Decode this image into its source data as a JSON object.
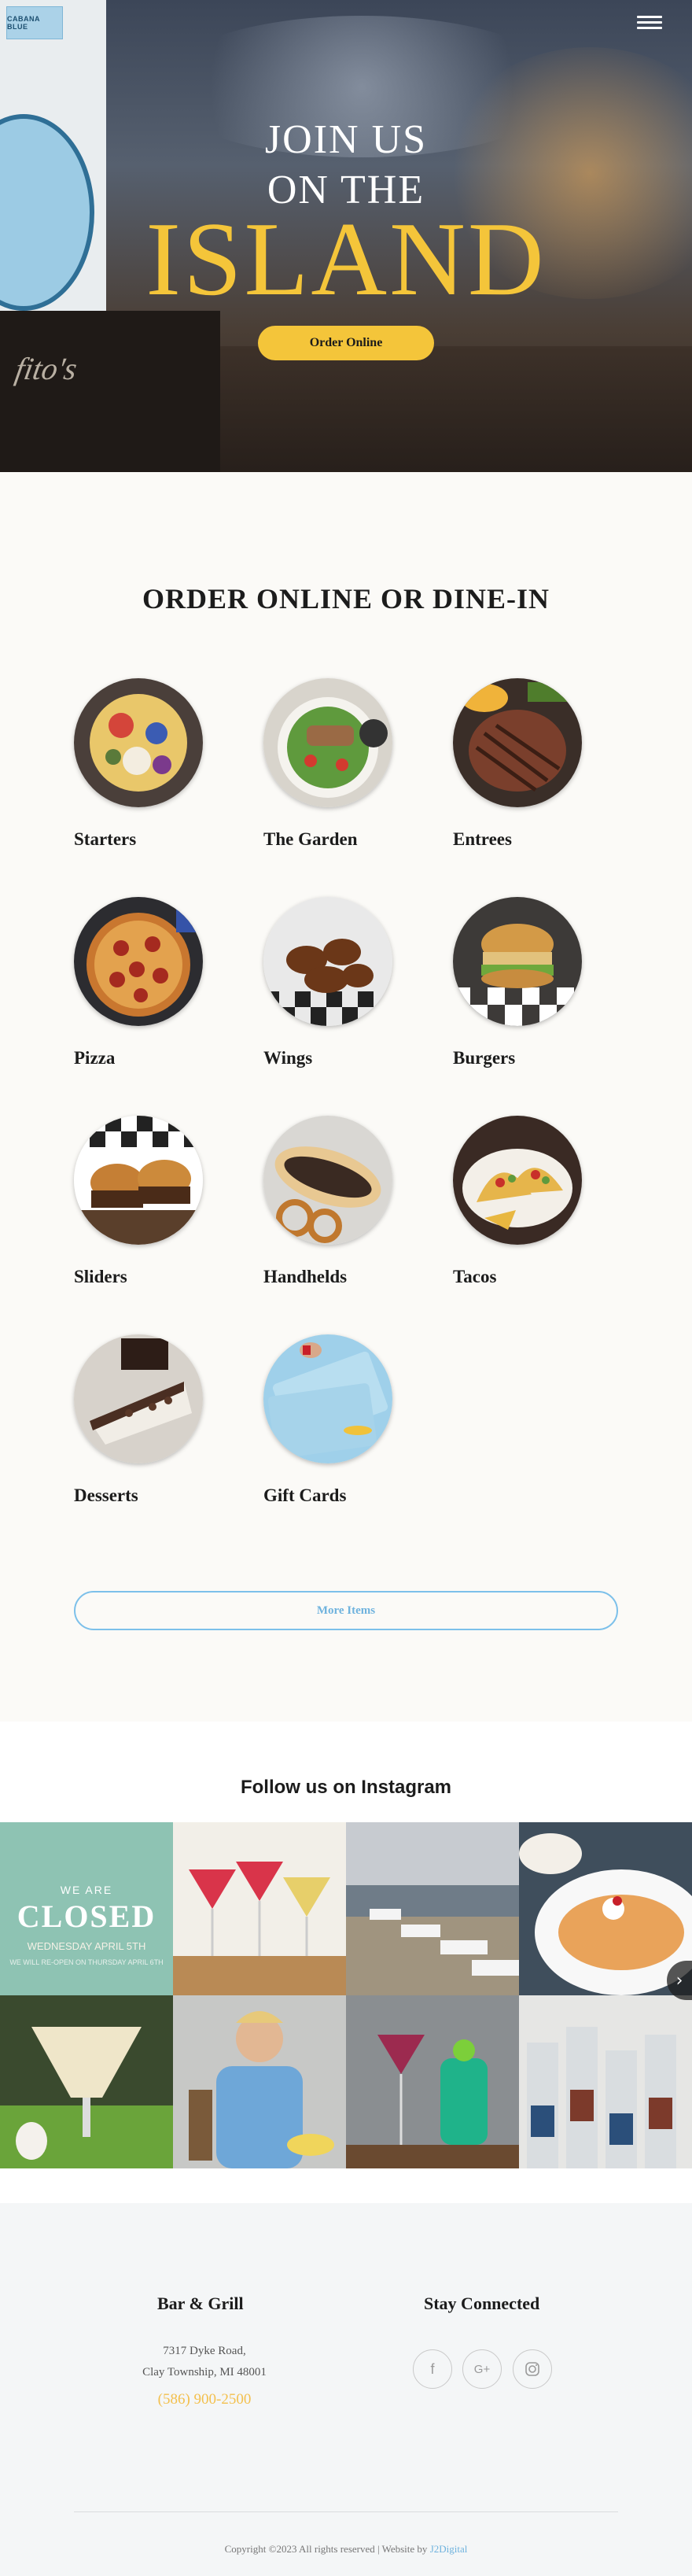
{
  "header": {
    "logo_text": "CABANA BLUE"
  },
  "hero": {
    "line1": "JOIN US",
    "line2": "ON THE",
    "big": "ISLAND",
    "order_button": "Order Online",
    "box_text": "fito's"
  },
  "menu": {
    "title": "ORDER ONLINE OR DINE-IN",
    "categories": [
      {
        "label": "Starters"
      },
      {
        "label": "The Garden"
      },
      {
        "label": "Entrees"
      },
      {
        "label": "Pizza"
      },
      {
        "label": "Wings"
      },
      {
        "label": "Burgers"
      },
      {
        "label": "Sliders"
      },
      {
        "label": "Handhelds"
      },
      {
        "label": "Tacos"
      },
      {
        "label": "Desserts"
      },
      {
        "label": "Gift Cards"
      }
    ],
    "more_button": "More Items"
  },
  "instagram": {
    "title": "Follow us on Instagram",
    "closed_post": {
      "we_are": "WE ARE",
      "closed": "CLOSED",
      "date": "WEDNESDAY APRIL 5TH",
      "sub": "WE WILL RE-OPEN ON THURSDAY APRIL 6TH"
    }
  },
  "footer": {
    "col1_title": "Bar & Grill",
    "address_line1": "7317 Dyke Road,",
    "address_line2": "Clay Township, MI 48001",
    "phone": "(586) 900-2500",
    "col2_title": "Stay Connected",
    "copyright_text": "Copyright ©2023 All rights reserved | Website by",
    "credit_link": "J2Digital"
  }
}
